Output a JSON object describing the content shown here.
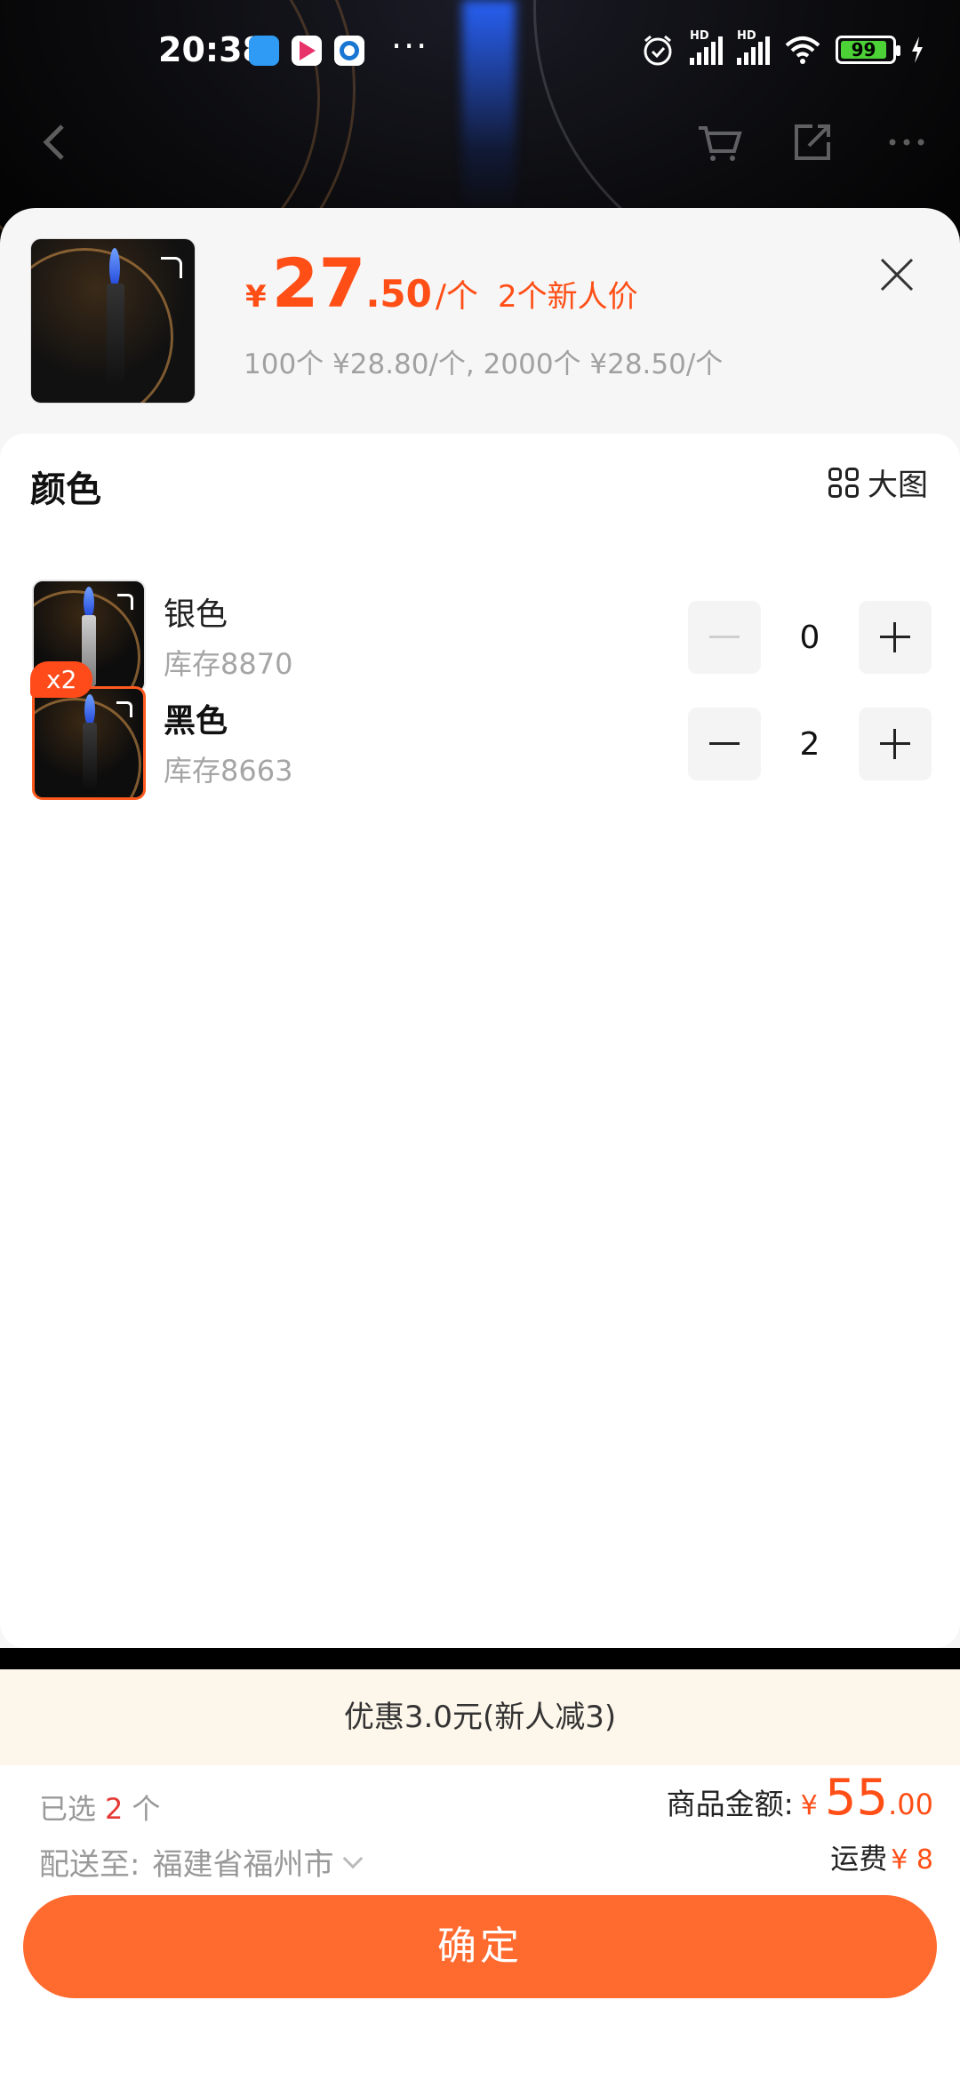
{
  "status_bar": {
    "time": "20:38",
    "more": "···",
    "battery": "99",
    "hd1": "HD",
    "hd2": "HD"
  },
  "product": {
    "price_symbol": "¥",
    "price_int": "27",
    "price_dec": ".50",
    "price_unit": "/个",
    "new_user_price": "2个新人价",
    "tier_prices": "100个 ¥28.80/个, 2000个 ¥28.50/个"
  },
  "section": {
    "title": "颜色",
    "big_view_label": "大图"
  },
  "variants": [
    {
      "name": "银色",
      "stock": "库存8870",
      "quantity": "0",
      "selected": false,
      "lighter_color": "#9a9a9a"
    },
    {
      "name": "黑色",
      "stock": "库存8663",
      "quantity": "2",
      "selected": true,
      "badge": "x2",
      "lighter_color": "#1c1c1c"
    }
  ],
  "discount": "优惠3.0元(新人减3)",
  "footer": {
    "selected_prefix": "已选",
    "selected_count": "2",
    "selected_suffix": "个",
    "ship_to_label": "配送至:",
    "ship_to_value": "福建省福州市",
    "amount_label": "商品金额:",
    "amount_symbol": "¥",
    "amount_int": "55",
    "amount_dec": ".00",
    "shipping_label": "运费",
    "shipping_value": "¥ 8",
    "confirm_label": "确定"
  },
  "colors": {
    "accent": "#ff4f17",
    "button": "#ff6a2f",
    "discount_bg": "#fdf6ea"
  }
}
